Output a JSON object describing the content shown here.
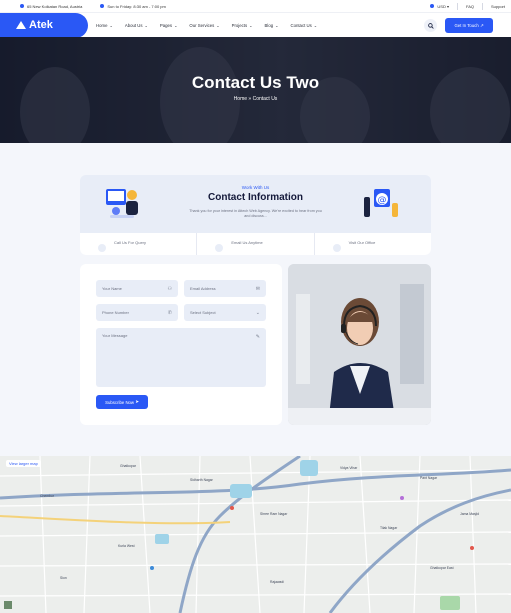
{
  "topbar": {
    "address": "65 New Kolkatan Road, Austria",
    "hours": "Sun to Friday: 8:30 am - 7:00 pm",
    "currency": "USD",
    "faq": "FAQ",
    "support": "Support"
  },
  "header": {
    "logo": "Atek",
    "nav": [
      "Home",
      "About Us",
      "Pages",
      "Our Services",
      "Projects",
      "Blog",
      "Contact Us"
    ],
    "cta": "Get In Touch"
  },
  "hero": {
    "title": "Contact Us Two",
    "crumb_home": "Home",
    "crumb_sep": "»",
    "crumb_current": "Contact Us"
  },
  "info": {
    "subtitle": "Work With Us",
    "title": "Contact Information",
    "description": "Thank you for your interest in Attech Web Agency. We're excited to hear from you and discuss...",
    "items": [
      {
        "label": "Call Us For Query"
      },
      {
        "label": "Email Us Anytime"
      },
      {
        "label": "Visit Our Office"
      }
    ]
  },
  "form": {
    "name_placeholder": "Your Name",
    "email_placeholder": "Email Address",
    "phone_placeholder": "Phone Number",
    "subject_placeholder": "Select Subject",
    "message_placeholder": "Your Message",
    "submit_label": "Subscribe Now"
  },
  "map": {
    "larger_map": "View larger map",
    "labels": [
      "Ghatkopar",
      "Sidharth Nagar",
      "Shree Ram Nagar",
      "Chembur",
      "Kurla West",
      "Vidya Vihar",
      "Pant Nagar",
      "Tilak Nagar",
      "Jama Masjid",
      "Sion",
      "Rajawadi",
      "Ghatkopar East"
    ]
  },
  "colors": {
    "accent": "#2a58f5",
    "dark": "#14193a",
    "panel": "#e8edf7"
  }
}
